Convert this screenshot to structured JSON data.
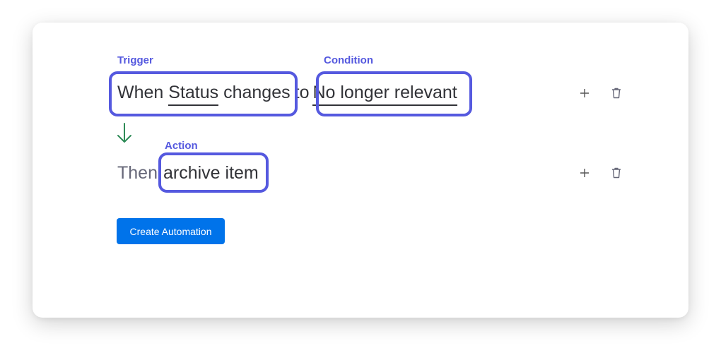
{
  "labels": {
    "trigger": "Trigger",
    "condition": "Condition",
    "action": "Action"
  },
  "trigger_row": {
    "when": "When",
    "column": "Status",
    "changes": "changes",
    "to": "to",
    "value": "No longer relevant"
  },
  "action_row": {
    "then": "Then",
    "action": "archive item"
  },
  "icons": {
    "add": "plus-icon",
    "delete": "trash-icon",
    "flow": "arrow-down-icon"
  },
  "colors": {
    "highlight": "#5559df",
    "primary": "#0073ea",
    "arrow": "#2e8b57"
  },
  "buttons": {
    "create": "Create Automation"
  }
}
